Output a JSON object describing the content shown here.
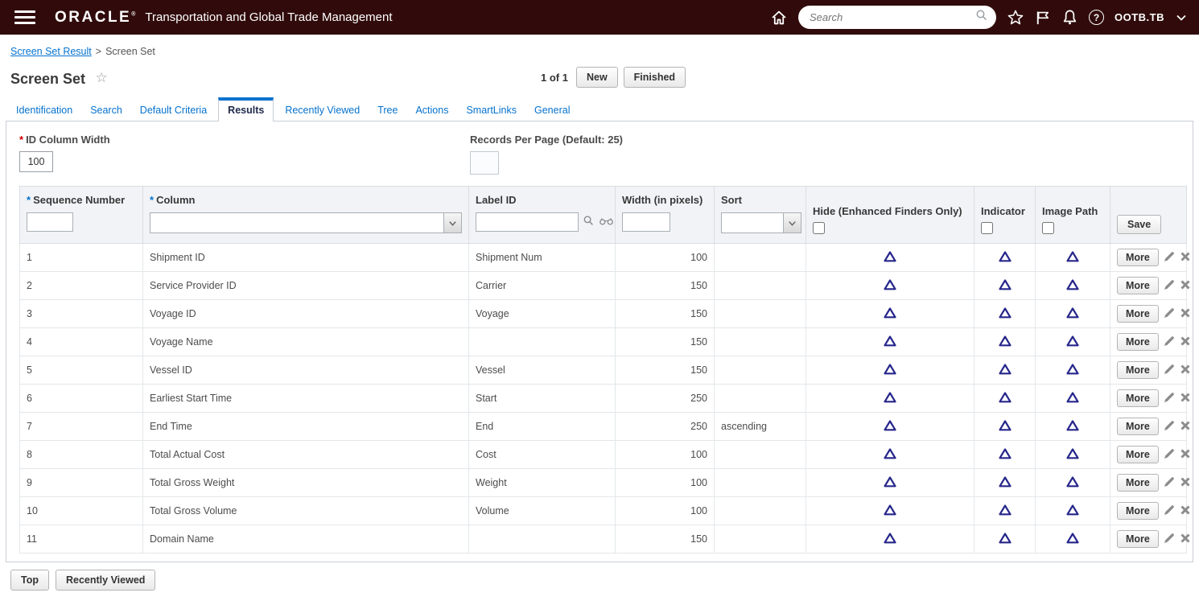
{
  "header": {
    "brand": "ORACLE",
    "brand_mark": "®",
    "app_title": "Transportation and Global Trade Management",
    "search_placeholder": "Search",
    "username": "OOTB.TB"
  },
  "icons": {
    "help_glyph": "?",
    "star_glyph": "☆"
  },
  "breadcrumb": {
    "parent": "Screen Set Result",
    "separator": ">",
    "current": "Screen Set"
  },
  "page": {
    "title": "Screen Set",
    "record_count": "1 of 1",
    "new_label": "New",
    "finished_label": "Finished"
  },
  "tabs": [
    "Identification",
    "Search",
    "Default Criteria",
    "Results",
    "Recently Viewed",
    "Tree",
    "Actions",
    "SmartLinks",
    "General"
  ],
  "active_tab": "Results",
  "form": {
    "required_marker": "*",
    "id_column_width": {
      "label": "ID Column Width",
      "value": "100"
    },
    "records_per_page": {
      "label": "Records Per Page (Default: 25)",
      "value": ""
    }
  },
  "results_table": {
    "headers": {
      "sequence_number": "Sequence Number",
      "column": "Column",
      "label_id": "Label ID",
      "width": "Width (in pixels)",
      "sort": "Sort",
      "hide": "Hide (Enhanced Finders Only)",
      "indicator": "Indicator",
      "image_path": "Image Path"
    },
    "save_label": "Save",
    "more_label": "More",
    "rows": [
      {
        "sequence": "1",
        "column": "Shipment ID",
        "label_id": "Shipment Num",
        "width": "100",
        "sort": ""
      },
      {
        "sequence": "2",
        "column": "Service Provider ID",
        "label_id": "Carrier",
        "width": "150",
        "sort": ""
      },
      {
        "sequence": "3",
        "column": "Voyage ID",
        "label_id": "Voyage",
        "width": "150",
        "sort": ""
      },
      {
        "sequence": "4",
        "column": "Voyage Name",
        "label_id": "",
        "width": "150",
        "sort": ""
      },
      {
        "sequence": "5",
        "column": "Vessel ID",
        "label_id": "Vessel",
        "width": "150",
        "sort": ""
      },
      {
        "sequence": "6",
        "column": "Earliest Start Time",
        "label_id": "Start",
        "width": "250",
        "sort": ""
      },
      {
        "sequence": "7",
        "column": "End Time",
        "label_id": "End",
        "width": "250",
        "sort": "ascending"
      },
      {
        "sequence": "8",
        "column": "Total Actual Cost",
        "label_id": "Cost",
        "width": "100",
        "sort": ""
      },
      {
        "sequence": "9",
        "column": "Total Gross Weight",
        "label_id": "Weight",
        "width": "100",
        "sort": ""
      },
      {
        "sequence": "10",
        "column": "Total Gross Volume",
        "label_id": "Volume",
        "width": "100",
        "sort": ""
      },
      {
        "sequence": "11",
        "column": "Domain Name",
        "label_id": "",
        "width": "150",
        "sort": ""
      }
    ]
  },
  "footer": {
    "top_label": "Top",
    "recently_viewed_label": "Recently Viewed"
  }
}
